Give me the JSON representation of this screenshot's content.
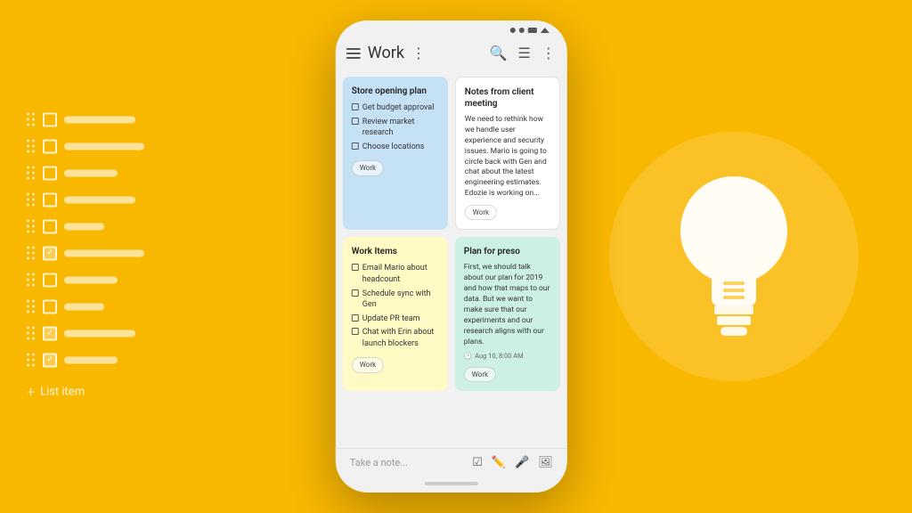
{
  "app": {
    "background_color": "#F9B800",
    "title": "Work"
  },
  "phone": {
    "header": {
      "title": "Work",
      "menu_icon": "hamburger-icon",
      "more_icon": "three-dots-icon",
      "search_icon": "search-icon",
      "view_icon": "grid-view-icon",
      "options_icon": "more-options-icon"
    },
    "notes": [
      {
        "id": "note-1",
        "color": "blue",
        "title": "Store opening plan",
        "type": "checklist",
        "items": [
          {
            "text": "Get budget approval",
            "checked": false
          },
          {
            "text": "Review market research",
            "checked": false
          },
          {
            "text": "Choose locations",
            "checked": false
          }
        ],
        "tag": "Work"
      },
      {
        "id": "note-2",
        "color": "white",
        "title": "Notes from client meeting",
        "type": "text",
        "content": "We need to rethink how we handle user experience and security issues. Mario is going to circle back with Gen and chat about the latest engineering estimates. Edozie is working on...",
        "tag": "Work"
      },
      {
        "id": "note-3",
        "color": "yellow",
        "title": "Work Items",
        "type": "checklist",
        "items": [
          {
            "text": "Email Mario about headcount",
            "checked": false
          },
          {
            "text": "Schedule sync with Gen",
            "checked": false
          },
          {
            "text": "Update PR team",
            "checked": false
          },
          {
            "text": "Chat with Erin about launch blockers",
            "checked": false
          }
        ],
        "tag": "Work"
      },
      {
        "id": "note-4",
        "color": "green",
        "title": "Plan for preso",
        "type": "text",
        "content": "First, we should talk about our plan for 2019 and how that maps to our data. But we want to make sure that our experiments and our research aligns with our plans.",
        "date": "Aug 10, 8:00 AM",
        "tag": "Work"
      }
    ],
    "bottom_bar": {
      "placeholder": "Take a note...",
      "icons": [
        "checkbox-icon",
        "pencil-icon",
        "microphone-icon",
        "image-icon"
      ]
    }
  },
  "left_checklist": {
    "items": [
      {
        "checked": false,
        "bar_size": "long"
      },
      {
        "checked": false,
        "bar_size": "xlong"
      },
      {
        "checked": false,
        "bar_size": "medium"
      },
      {
        "checked": false,
        "bar_size": "long"
      },
      {
        "checked": false,
        "bar_size": "short"
      },
      {
        "checked": true,
        "bar_size": "xlong"
      },
      {
        "checked": false,
        "bar_size": "medium"
      },
      {
        "checked": false,
        "bar_size": "short"
      },
      {
        "checked": true,
        "bar_size": "long"
      },
      {
        "checked": true,
        "bar_size": "medium"
      }
    ],
    "add_label": "List item"
  }
}
